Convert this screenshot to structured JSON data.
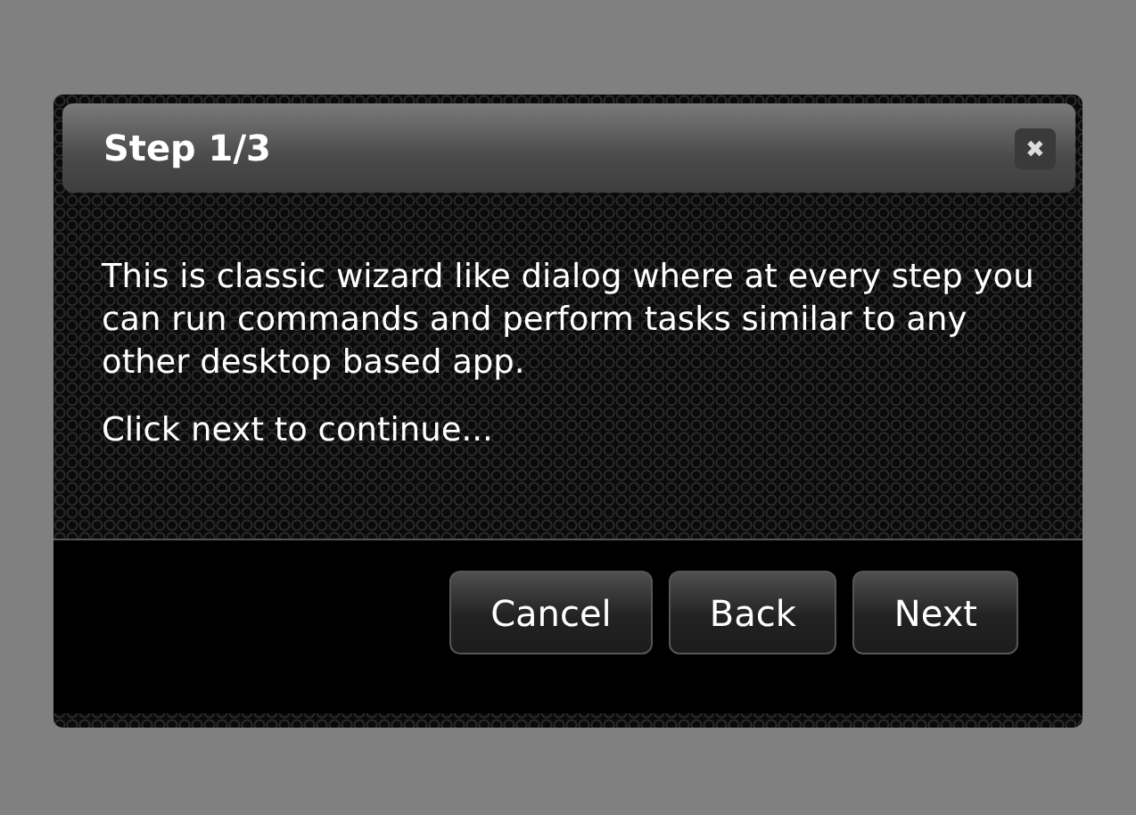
{
  "dialog": {
    "title": "Step 1/3",
    "close_icon": "✖",
    "paragraphs": [
      "This is classic wizard like dialog where at every step you can run commands and perform tasks similar to any other desktop based app.",
      "Click next to continue..."
    ],
    "buttons": [
      "Cancel",
      "Back",
      "Next"
    ]
  }
}
